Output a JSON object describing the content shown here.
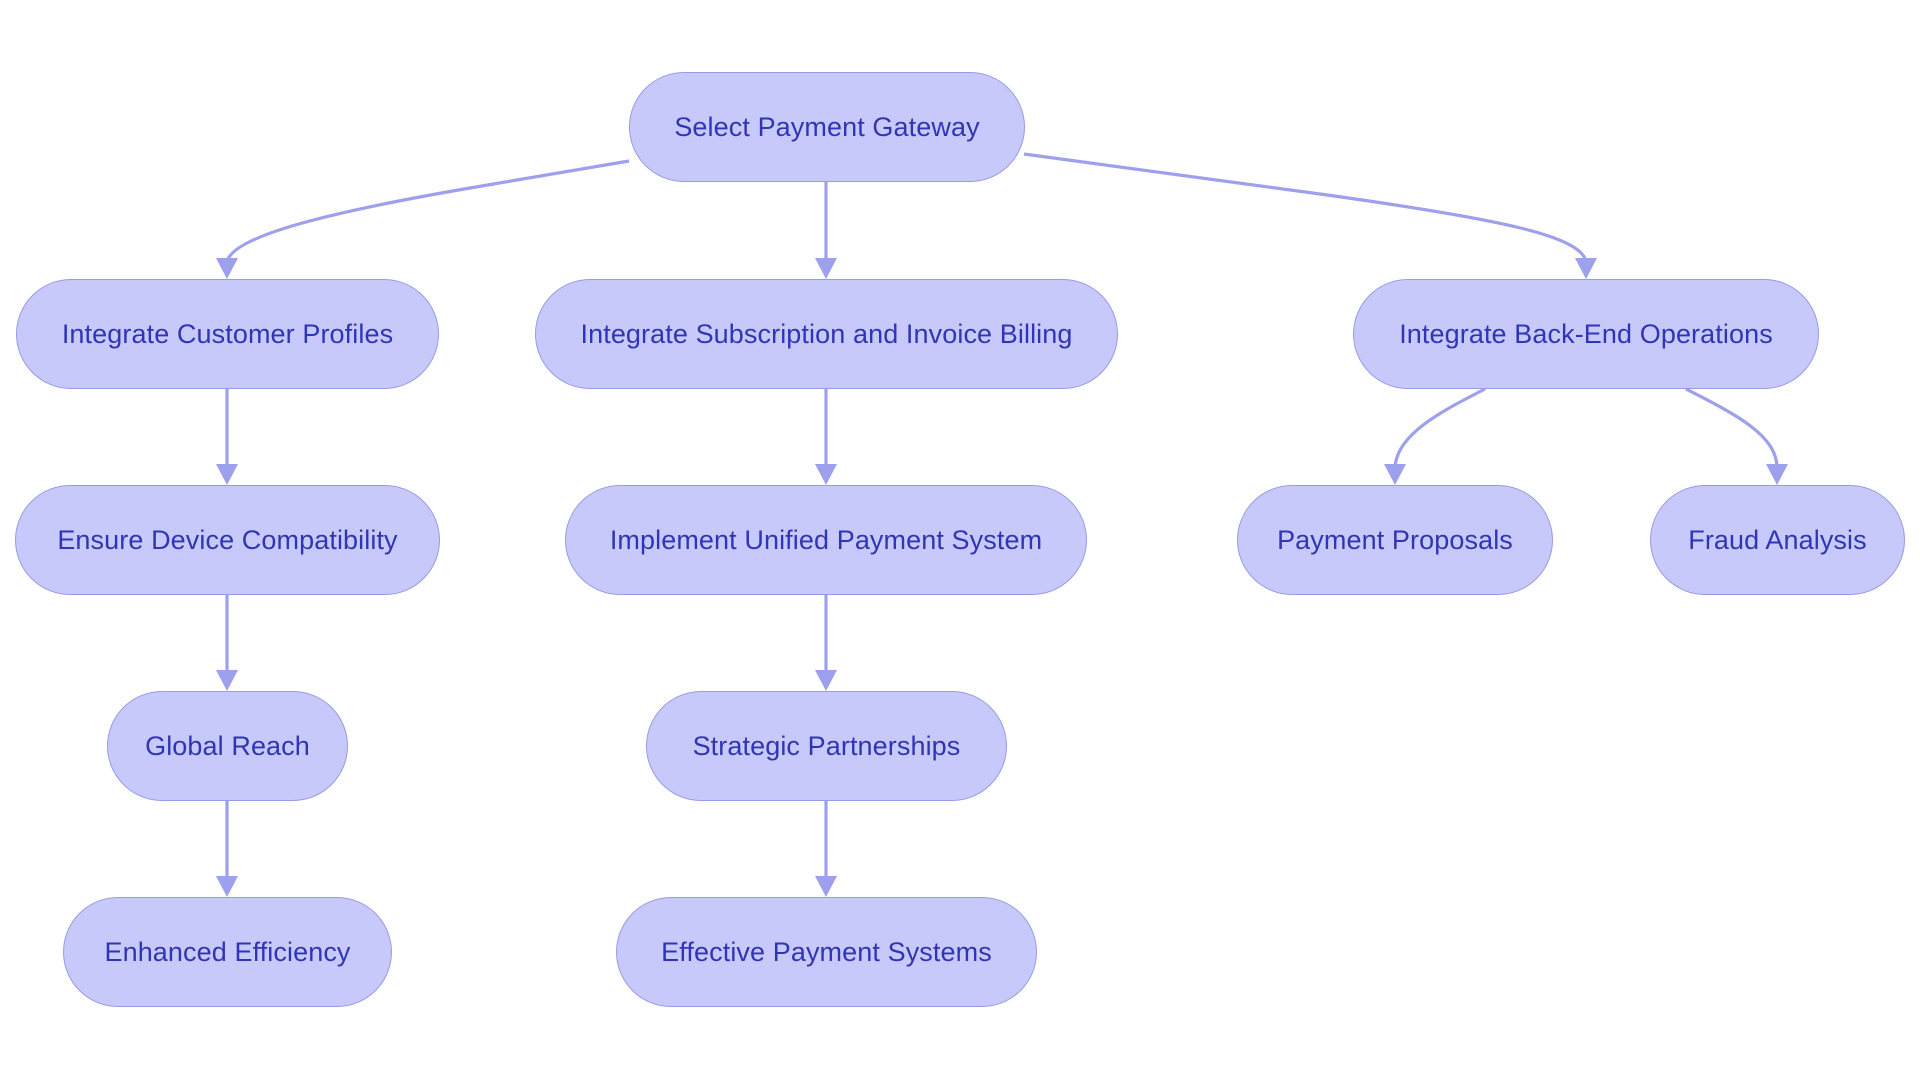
{
  "diagram": {
    "type": "flowchart",
    "colors": {
      "node_fill": "#C8C9FB",
      "node_border": "#979BE6",
      "node_text": "#2F35B4",
      "edge": "#9DA0EC",
      "background": "#FFFFFF"
    },
    "nodes": {
      "root": {
        "label": "Select Payment Gateway"
      },
      "customer_profiles": {
        "label": "Integrate Customer Profiles"
      },
      "subscription_billing": {
        "label": "Integrate Subscription and Invoice Billing"
      },
      "backend_ops": {
        "label": "Integrate Back-End Operations"
      },
      "device_compat": {
        "label": "Ensure Device Compatibility"
      },
      "unified_payment": {
        "label": "Implement Unified Payment System"
      },
      "payment_proposals": {
        "label": "Payment Proposals"
      },
      "fraud_analysis": {
        "label": "Fraud Analysis"
      },
      "global_reach": {
        "label": "Global Reach"
      },
      "strategic_partnerships": {
        "label": "Strategic Partnerships"
      },
      "enhanced_efficiency": {
        "label": "Enhanced Efficiency"
      },
      "effective_payment": {
        "label": "Effective Payment Systems"
      }
    },
    "edges": [
      {
        "from": "root",
        "to": "customer_profiles"
      },
      {
        "from": "root",
        "to": "subscription_billing"
      },
      {
        "from": "root",
        "to": "backend_ops"
      },
      {
        "from": "customer_profiles",
        "to": "device_compat"
      },
      {
        "from": "device_compat",
        "to": "global_reach"
      },
      {
        "from": "global_reach",
        "to": "enhanced_efficiency"
      },
      {
        "from": "subscription_billing",
        "to": "unified_payment"
      },
      {
        "from": "unified_payment",
        "to": "strategic_partnerships"
      },
      {
        "from": "strategic_partnerships",
        "to": "effective_payment"
      },
      {
        "from": "backend_ops",
        "to": "payment_proposals"
      },
      {
        "from": "backend_ops",
        "to": "fraud_analysis"
      }
    ]
  }
}
